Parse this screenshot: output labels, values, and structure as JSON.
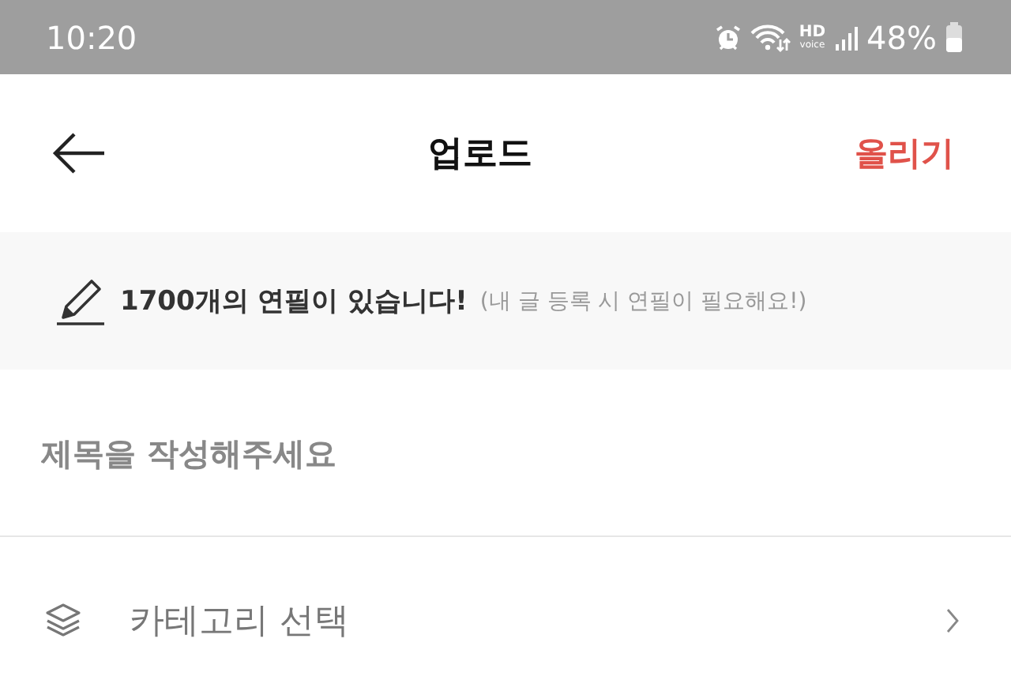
{
  "status_bar": {
    "time": "10:20",
    "network_label": "HD",
    "network_sublabel": "voice",
    "battery": "48%"
  },
  "header": {
    "title": "업로드",
    "action": "올리기"
  },
  "notice": {
    "message": "1700개의 연필이 있습니다!",
    "hint": "(내 글 등록 시 연필이 필요해요!)"
  },
  "title_field": {
    "placeholder": "제목을 작성해주세요"
  },
  "category_row": {
    "label": "카테고리 선택"
  }
}
